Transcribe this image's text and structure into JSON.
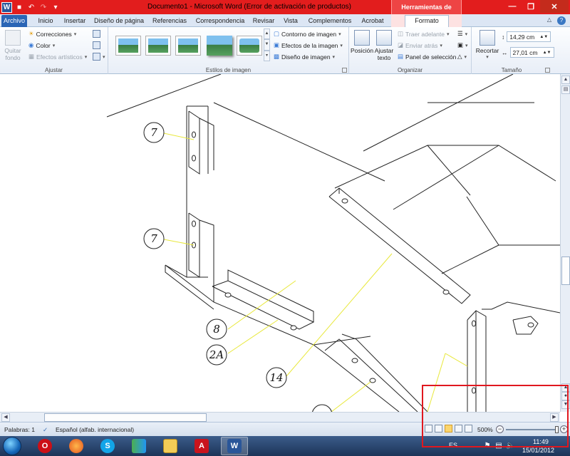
{
  "titlebar": {
    "title": "Documento1  -  Microsoft Word (Error de activación de productos)",
    "context_title": "Herramientas de imagen",
    "app_letter": "W",
    "accent_color": "#e21d1d"
  },
  "tabs": [
    {
      "label": "Archivo",
      "type": "file"
    },
    {
      "label": "Inicio"
    },
    {
      "label": "Insertar"
    },
    {
      "label": "Diseño de página"
    },
    {
      "label": "Referencias"
    },
    {
      "label": "Correspondencia"
    },
    {
      "label": "Revisar"
    },
    {
      "label": "Vista"
    },
    {
      "label": "Complementos"
    },
    {
      "label": "Acrobat"
    },
    {
      "label": "Formato",
      "active": true
    }
  ],
  "ribbon": {
    "ajustar": {
      "label": "Ajustar",
      "quitar_fondo": "Quitar fondo",
      "correcciones": "Correcciones",
      "color": "Color",
      "efectos_artisticos": "Efectos artísticos"
    },
    "estilos": {
      "label": "Estilos de imagen",
      "contorno": "Contorno de imagen",
      "efectos": "Efectos de la imagen",
      "diseno": "Diseño de imagen"
    },
    "organizar": {
      "label": "Organizar",
      "posicion": "Posición",
      "ajustar_texto": "Ajustar texto",
      "traer_adelante": "Traer adelante",
      "enviar_atras": "Enviar atrás",
      "panel_seleccion": "Panel de selección"
    },
    "tamano": {
      "label": "Tamaño",
      "recortar": "Recortar",
      "height": "14,29 cm",
      "width": "27,01 cm"
    }
  },
  "drawing": {
    "balloons": [
      "7",
      "7",
      "8",
      "2A",
      "14"
    ]
  },
  "statusbar": {
    "words": "Palabras: 1",
    "language": "Español (alfab. internacional)",
    "zoom": "500%",
    "zoom_fraction": 1.0
  },
  "taskbar": {
    "lang": "ES",
    "time": "11:49",
    "date": "15/01/2012",
    "apps": [
      "windows-explorer",
      "opera",
      "firefox",
      "skype",
      "messenger",
      "folder",
      "acrobat",
      "word"
    ]
  }
}
